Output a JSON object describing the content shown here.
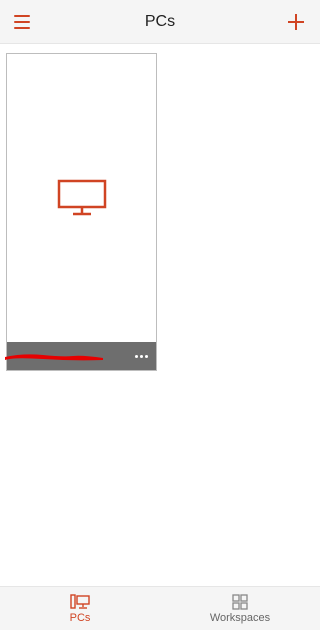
{
  "header": {
    "title": "PCs",
    "menu_icon": "hamburger-menu-icon",
    "add_icon": "plus-icon"
  },
  "pcs": [
    {
      "name": "",
      "thumbnail_icon": "monitor-icon",
      "more_icon": "more-options-icon",
      "name_redacted": true
    }
  ],
  "bottom_nav": {
    "pcs_label": "PCs",
    "workspaces_label": "Workspaces",
    "active": "PCs"
  },
  "colors": {
    "accent": "#d04423",
    "card_footer": "#6e6e6e",
    "redaction": "#e60000",
    "bar_background": "#f5f5f5"
  }
}
